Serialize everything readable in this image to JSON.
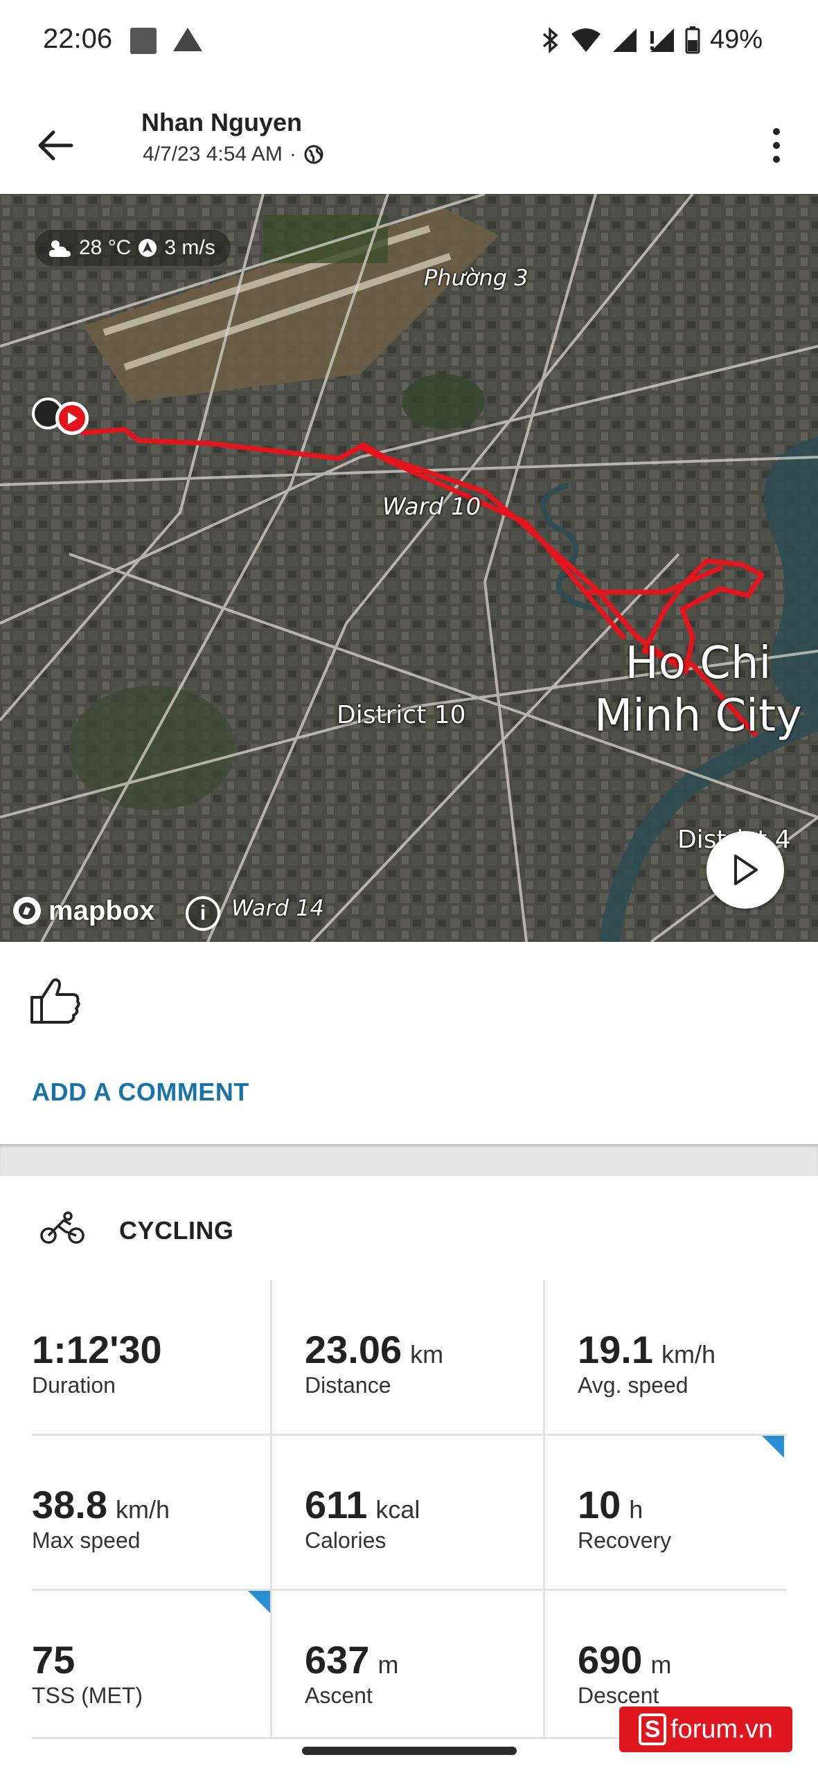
{
  "status_bar": {
    "time": "22:06",
    "battery": "49%"
  },
  "header": {
    "user_name": "Nhan Nguyen",
    "datetime": "4/7/23 4:54 AM",
    "separator": "·",
    "privacy_icon": "globe-icon"
  },
  "map": {
    "weather": {
      "temperature": "28 °C",
      "wind": "3 m/s"
    },
    "labels": {
      "phuong3": "Phường 3",
      "ward10": "Ward 10",
      "district10": "District 10",
      "hcm_line1": "Ho Chi",
      "hcm_line2": "Minh City",
      "district4": "District 4",
      "ward14": "Ward 14"
    },
    "attribution": "mapbox",
    "route_color": "#e3141b"
  },
  "social": {
    "like_icon": "thumbs-up-icon",
    "add_comment": "ADD A COMMENT"
  },
  "activity": {
    "sport_icon": "cycling-icon",
    "sport": "CYCLING",
    "stats": [
      {
        "value": "1:12'30",
        "unit": "",
        "label": "Duration"
      },
      {
        "value": "23.06",
        "unit": "km",
        "label": "Distance"
      },
      {
        "value": "19.1",
        "unit": "km/h",
        "label": "Avg. speed"
      },
      {
        "value": "38.8",
        "unit": "km/h",
        "label": "Max speed"
      },
      {
        "value": "611",
        "unit": "kcal",
        "label": "Calories"
      },
      {
        "value": "10",
        "unit": "h",
        "label": "Recovery"
      },
      {
        "value": "75",
        "unit": "",
        "label": "TSS (MET)"
      },
      {
        "value": "637",
        "unit": "m",
        "label": "Ascent"
      },
      {
        "value": "690",
        "unit": "m",
        "label": "Descent"
      }
    ]
  },
  "watermark": {
    "letter": "S",
    "text": "forum.vn"
  },
  "colors": {
    "accent": "#1a73a8",
    "corner_marker": "#2a8fd0"
  }
}
